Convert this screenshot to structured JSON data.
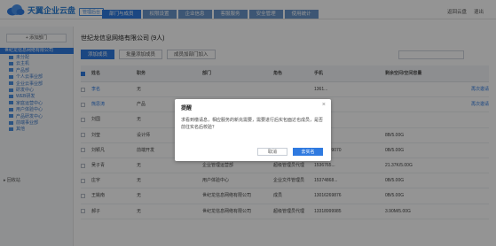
{
  "header": {
    "logo_text": "天翼企业云盘",
    "admin_badge": "管理后台",
    "nav_tabs": [
      {
        "label": "部门与成员",
        "active": true
      },
      {
        "label": "权限设置",
        "active": false
      },
      {
        "label": "企业信息",
        "active": false
      },
      {
        "label": "客服服务",
        "active": false
      },
      {
        "label": "安全管理",
        "active": false
      },
      {
        "label": "使用统计",
        "active": false
      }
    ],
    "right_links": [
      "返回云盘",
      "退出"
    ]
  },
  "sidebar": {
    "add_dept_label": "+ 添加部门",
    "root_label": "世纪龙信息网络有限公司",
    "items": [
      "未分配",
      "云主机",
      "产品部",
      "个人云事业部",
      "企业云事业部",
      "研发中心",
      "WEB研发",
      "家庭运营中心",
      "用户体验中心",
      "产品研发中心",
      "前端事业部",
      "其他"
    ],
    "recycle_label": "▸ 回收站"
  },
  "content": {
    "company_title": "世纪龙信息网络有限公司 (9人)",
    "toolbar": {
      "add_member": "添加成员",
      "batch_add": "批量添加成员",
      "invite": "成员加部门加入"
    },
    "search_placeholder": "",
    "table": {
      "headers": [
        "姓名",
        "职务",
        "部门",
        "角色",
        "手机",
        "剩余空间/空间容量",
        ""
      ],
      "rows": [
        {
          "name": "李名",
          "title": "无",
          "dept": "",
          "role": "",
          "phone": "1361...",
          "space": "",
          "action": "再次邀请",
          "name_link": true
        },
        {
          "name": "熊思涛",
          "title": "产品",
          "dept": "",
          "role": "",
          "phone": "...",
          "space": "",
          "action": "再次邀请",
          "name_link": true
        },
        {
          "name": "刘国",
          "title": "无",
          "dept": "",
          "role": "",
          "phone": "",
          "space": "",
          "action": "",
          "name_link": false
        },
        {
          "name": "刘莹",
          "title": "设计师",
          "dept": "",
          "role": "",
          "phone": "",
          "space": "8B/5.00G",
          "action": "",
          "name_link": false
        },
        {
          "name": "刘颖凡",
          "title": "前端开发",
          "dept": "用户体验中心",
          "role": "普通成员",
          "phone": "13126799070",
          "space": "0B/5.00G",
          "action": "",
          "name_link": false
        },
        {
          "name": "吴子青",
          "title": "无",
          "dept": "企业管理运营部",
          "role": "超级管理员代理",
          "phone": "1536765...",
          "space": "21.37K/5.00G",
          "action": "",
          "name_link": false
        },
        {
          "name": "庄宇",
          "title": "无",
          "dept": "用户体验中心",
          "role": "企业文件管理员",
          "phone": "15374868...",
          "space": "0B/5.00G",
          "action": "",
          "name_link": false
        },
        {
          "name": "王姚南",
          "title": "无",
          "dept": "世纪龙信息网络有限公司",
          "role": "成员",
          "phone": "13016269876",
          "space": "0B/5.00G",
          "action": "",
          "name_link": false
        },
        {
          "name": "郝子",
          "title": "无",
          "dept": "世纪龙信息网络有限公司",
          "role": "超级管理员代理",
          "phone": "13318999985",
          "space": "3.90M/5.00G",
          "action": "",
          "name_link": false
        }
      ]
    }
  },
  "modal": {
    "title": "提醒",
    "message": "求看到缴请息，相应服务的新充需要，需要进行后实包面达也成员，是否前往实名后校验？",
    "cancel_label": "取消",
    "confirm_label": "去实名"
  }
}
